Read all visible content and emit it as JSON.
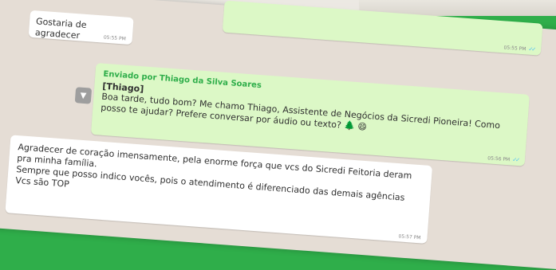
{
  "messages": {
    "gostaria": {
      "text": "Gostaria de agradecer",
      "time": "05:55 PM"
    },
    "top_outgoing": {
      "time": "05:55 PM"
    },
    "agent": {
      "forwarded_label": "Enviado por Thiago da Silva Soares",
      "agent_name": "[Thiago]",
      "body": "Boa tarde, tudo bom? Me chamo Thiago, Assistente de Negócios da Sicredi Pioneira! Como posso te ajudar? Prefere conversar por áudio ou texto? 🌲 😄",
      "time": "05:56 PM"
    },
    "thanks": {
      "line1": "Agradecer de coração imensamente, pela enorme força que vcs do Sicredi Feitoria deram pra minha família.",
      "line2": "Sempre que posso indico vocês, pois o atendimento é diferenciado das demais agências",
      "line3": "Vcs são TOP",
      "time": "05:57 PM"
    }
  },
  "colors": {
    "background": "#2fae4a",
    "chat_bg": "#e5ddd5",
    "outgoing": "#dcf8c6",
    "incoming": "#ffffff",
    "sender": "#2fae4a",
    "read_ticks": "#4fc3f7"
  },
  "icons": {
    "chevron": "chevron-down-icon",
    "ticks": "double-check-icon"
  }
}
